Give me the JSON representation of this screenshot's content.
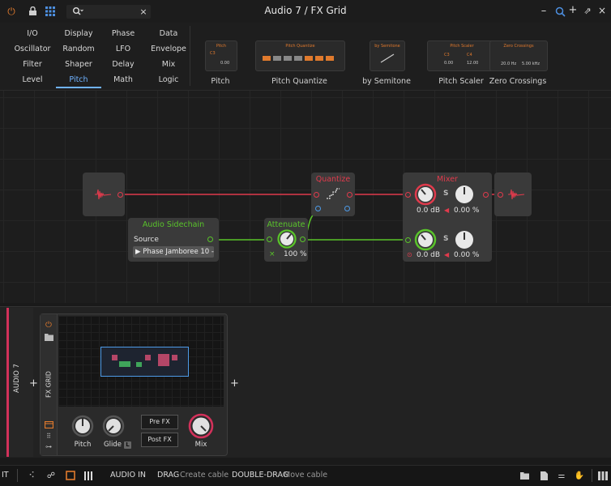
{
  "window": {
    "title": "Audio 7 / FX Grid"
  },
  "browser": {
    "search_icon": "search-icon",
    "categories": [
      [
        "I/O",
        "Display",
        "Phase",
        "Data"
      ],
      [
        "Oscillator",
        "Random",
        "LFO",
        "Envelope"
      ],
      [
        "Filter",
        "Shaper",
        "Delay",
        "Mix"
      ],
      [
        "Level",
        "Pitch",
        "Math",
        "Logic"
      ]
    ],
    "selected_category": "Pitch",
    "devices": [
      {
        "label": "Pitch",
        "thumb_title": "Pitch",
        "thumb_vals": [
          "C3",
          "0.00"
        ]
      },
      {
        "label": "Pitch Quantize",
        "thumb_title": "Pitch Quantize",
        "thumb_vals": []
      },
      {
        "label": "by Semitone",
        "thumb_title": "by Semitone",
        "thumb_vals": []
      },
      {
        "label": "Pitch Scaler",
        "thumb_title": "Pitch Scaler",
        "thumb_vals": [
          "C3",
          "C4",
          "0.00",
          "12.00"
        ]
      },
      {
        "label": "Zero Crossings",
        "thumb_title": "Zero Crossings",
        "thumb_vals": [
          "20.0 Hz",
          "5.00 kHz"
        ]
      }
    ]
  },
  "grid": {
    "quantize": {
      "title": "Quantize"
    },
    "mixer": {
      "title": "Mixer",
      "ch1_gain": "0.0 dB",
      "ch1_pan": "0.00 %",
      "ch2_gain": "0.0 dB",
      "ch2_pan": "0.00 %",
      "s_label": "S"
    },
    "sidechain": {
      "title": "Audio Sidechain",
      "source_label": "Source",
      "source_value": "▶ Phase Jamboree 10 - ▾"
    },
    "attenuate": {
      "title": "Attenuate",
      "value": "100 %",
      "x_label": "×"
    }
  },
  "device_panel": {
    "track_name": "AUDIO 7",
    "device_name": "FX GRID",
    "knobs": [
      {
        "label": "Pitch"
      },
      {
        "label": "Glide"
      },
      {
        "label": "Mix"
      }
    ],
    "glide_badge": "L",
    "pre_fx": "Pre FX",
    "post_fx": "Post FX",
    "plus": "+"
  },
  "statusbar": {
    "left_text": "IT",
    "audio_in": "AUDIO IN",
    "drag_key": "DRAG",
    "drag_action": "Create cable",
    "dbl_key": "DOUBLE-DRAG",
    "dbl_action": "Move cable"
  },
  "colors": {
    "accent": "#6fb2ff",
    "red": "#e03a4c",
    "green": "#59c32a",
    "orange": "#e07a2d",
    "track": "#d2315a"
  }
}
